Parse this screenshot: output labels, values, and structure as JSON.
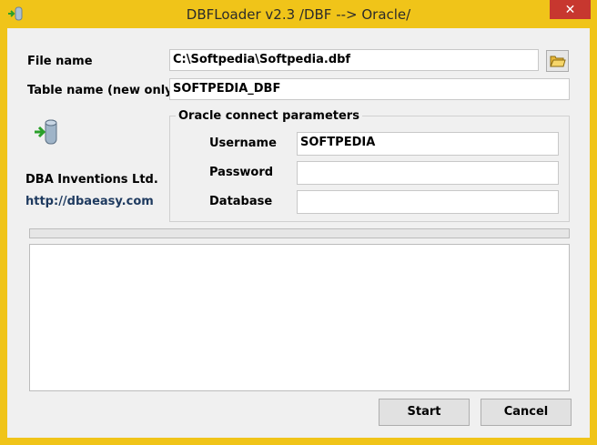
{
  "window": {
    "title": "DBFLoader v2.3  /DBF --> Oracle/",
    "close_glyph": "✕"
  },
  "form": {
    "file_name_label": "File name",
    "file_name_value": "C:\\Softpedia\\Softpedia.dbf",
    "table_name_label": "Table name (new only)",
    "table_name_value": "SOFTPEDIA_DBF"
  },
  "vendor": {
    "name": "DBA Inventions Ltd.",
    "url": "http://dbaeasy.com"
  },
  "oracle": {
    "group_title": "Oracle connect parameters",
    "username_label": "Username",
    "username_value": "SOFTPEDIA",
    "password_label": "Password",
    "password_value": "",
    "database_label": "Database",
    "database_value": ""
  },
  "buttons": {
    "start": "Start",
    "cancel": "Cancel"
  },
  "progress": {
    "value": 0
  },
  "colors": {
    "titlebar": "#f0c419",
    "close": "#c7372f",
    "client": "#f0f0f0",
    "link": "#1e3a5f"
  },
  "icons": {
    "app": "db-import-icon",
    "browse": "folder-open-icon",
    "logo": "db-import-icon"
  }
}
